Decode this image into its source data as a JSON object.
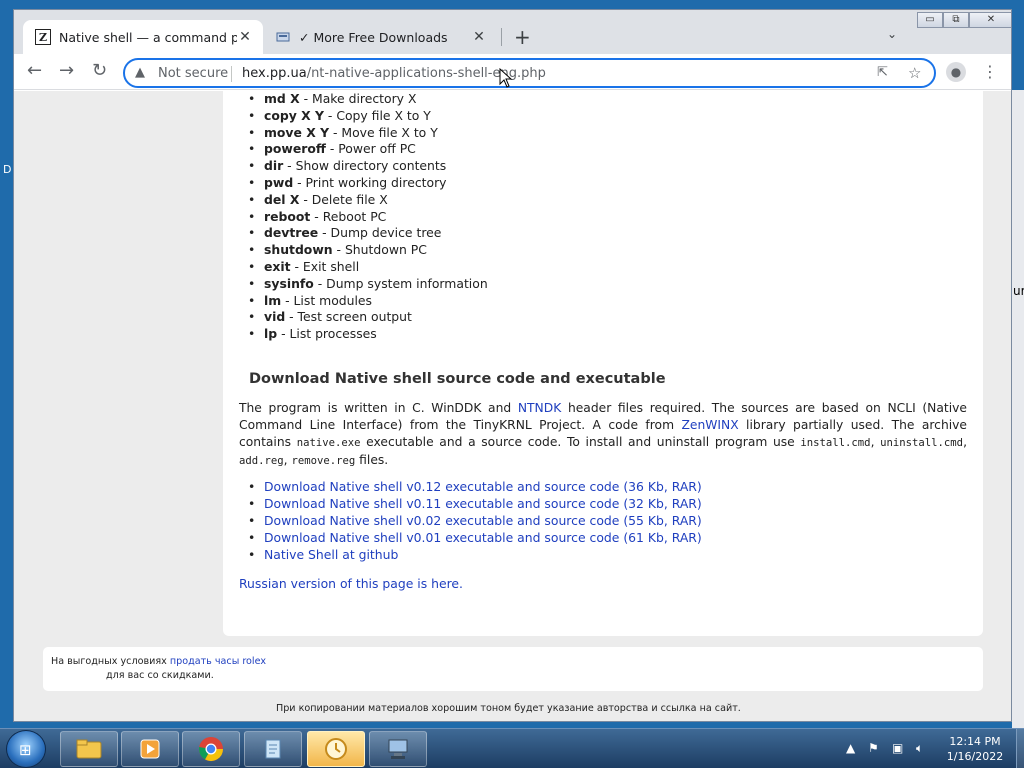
{
  "browser": {
    "tabs": [
      {
        "title": "Native shell — a command prom",
        "favicon": "zen-icon"
      },
      {
        "title": "✓ More Free Downloads",
        "favicon": "download-icon"
      }
    ],
    "window_controls": [
      "minimize",
      "maximize",
      "close"
    ],
    "security_label": "Not secure",
    "url_host": "hex.pp.ua",
    "url_path": "/nt-native-applications-shell-eng.php"
  },
  "page": {
    "commands": [
      {
        "cmd": "md X",
        "desc": " - Make directory X"
      },
      {
        "cmd": "copy X Y",
        "desc": " - Copy file X to Y"
      },
      {
        "cmd": "move X Y",
        "desc": " - Move file X to Y"
      },
      {
        "cmd": "poweroff",
        "desc": " - Power off PC"
      },
      {
        "cmd": "dir",
        "desc": " - Show directory contents"
      },
      {
        "cmd": "pwd",
        "desc": " - Print working directory"
      },
      {
        "cmd": "del X",
        "desc": " - Delete file X"
      },
      {
        "cmd": "reboot",
        "desc": " - Reboot PC"
      },
      {
        "cmd": "devtree",
        "desc": " - Dump device tree"
      },
      {
        "cmd": "shutdown",
        "desc": " - Shutdown PC"
      },
      {
        "cmd": "exit",
        "desc": " - Exit shell"
      },
      {
        "cmd": "sysinfo",
        "desc": " - Dump system information"
      },
      {
        "cmd": "lm",
        "desc": " - List modules"
      },
      {
        "cmd": "vid",
        "desc": " - Test screen output"
      },
      {
        "cmd": "lp",
        "desc": " - List processes"
      }
    ],
    "download_heading": "Download Native shell source code and executable",
    "desc": {
      "t1": "The program is written in C. WinDDK and ",
      "link_ntndk": "NTNDK",
      "t2": " header files required. The sources are based on NCLI (Native Command Line Interface) from the TinyKRNL Project. A code from ",
      "link_zenwinx": "ZenWINX",
      "t3": " library partially used. The archive contains ",
      "code_native": "native.exe",
      "t4": " executable and a source code. To install and uninstall program use ",
      "code_install": "install.cmd",
      "sep1": ", ",
      "code_uninstall": "uninstall.cmd",
      "sep2": ", ",
      "code_addreg": "add.reg",
      "sep3": ", ",
      "code_removereg": "remove.reg",
      "t5": " files."
    },
    "downloads": [
      "Download Native shell v0.12 executable and source code (36 Kb, RAR)",
      "Download Native shell v0.11 executable and source code (32 Kb, RAR)",
      "Download Native shell v0.02 executable and source code (55 Kb, RAR)",
      "Download Native shell v0.01 executable and source code (61 Kb, RAR)",
      "Native Shell at github"
    ],
    "russian_link": "Russian version of this page is here.",
    "ad": {
      "line1_text": "На выгодных условиях ",
      "line1_link": "продать часы rolex",
      "line2": "для вас со скидками."
    },
    "footer": "При копировании материалов хорошим тоном будет указание авторства и ссылка на сайт."
  },
  "desktop": {
    "left_char": "D",
    "right_char": "ur"
  },
  "taskbar": {
    "apps": [
      "explorer-icon",
      "media-player-icon",
      "chrome-icon",
      "notepad-icon",
      "app-icon",
      "network-app-icon"
    ],
    "time": "12:14 PM",
    "date": "1/16/2022"
  }
}
